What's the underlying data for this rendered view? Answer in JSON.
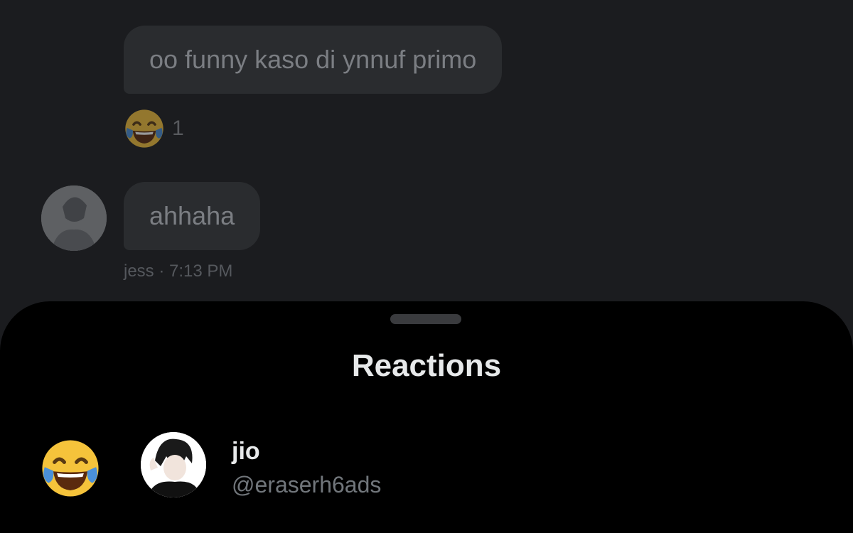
{
  "chat": {
    "messages": [
      {
        "text": "oo funny kaso di ynnuf primo"
      },
      {
        "text": "ahhaha",
        "sender": "jess",
        "time": "7:13 PM"
      }
    ],
    "reaction": {
      "emoji_icon": "face-with-tears-of-joy-icon",
      "count": "1"
    },
    "meta_text": "jess · 7:13 PM"
  },
  "sheet": {
    "title": "Reactions",
    "reactions": [
      {
        "emoji_icon": "face-with-tears-of-joy-icon",
        "name": "jio",
        "handle": "@eraserh6ads"
      }
    ]
  },
  "colors": {
    "background": "#1b1c1f",
    "bubble": "#2a2c2f",
    "sheet": "#000000",
    "primary_text": "#e7e9ea",
    "secondary_text": "#71767b"
  }
}
